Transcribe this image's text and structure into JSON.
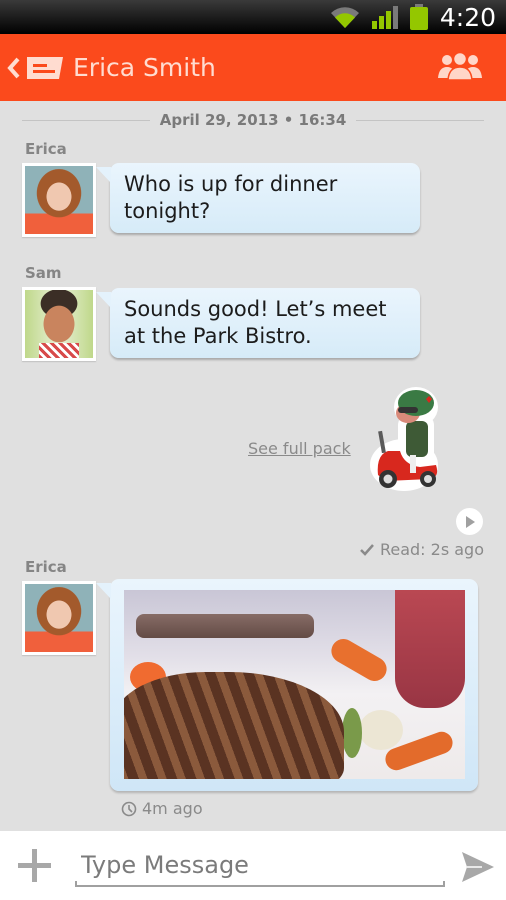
{
  "status_bar": {
    "time": "4:20",
    "icons": [
      "wifi-icon",
      "signal-icon",
      "battery-icon"
    ]
  },
  "app_bar": {
    "title": "Erica Smith",
    "back_icon": "chevron-left-icon",
    "conversation_icon": "message-icon",
    "action_icon": "people-icon"
  },
  "conversation": {
    "date_separator": "April 29, 2013 • 16:34",
    "messages": [
      {
        "sender": "Erica",
        "type": "text",
        "text": "Who is up for dinner tonight?"
      },
      {
        "sender": "Sam",
        "type": "text",
        "text": "Sounds good!  Let’s meet at the Park Bistro."
      },
      {
        "sender": "me",
        "type": "sticker",
        "sticker": "scooter-rider-sticker",
        "see_pack_label": "See full pack",
        "read_status": "Read: 2s ago"
      },
      {
        "sender": "Erica",
        "type": "photo",
        "photo": "steak-dinner-photo",
        "time_ago": "4m ago"
      }
    ]
  },
  "composer": {
    "placeholder": "Type Message",
    "value": "",
    "attach_icon": "plus-icon",
    "send_icon": "send-icon"
  },
  "colors": {
    "accent": "#fb4a1c",
    "background": "#e0e0e0",
    "bubble": "#dbeefa",
    "title_text": "#ffdcd0"
  }
}
